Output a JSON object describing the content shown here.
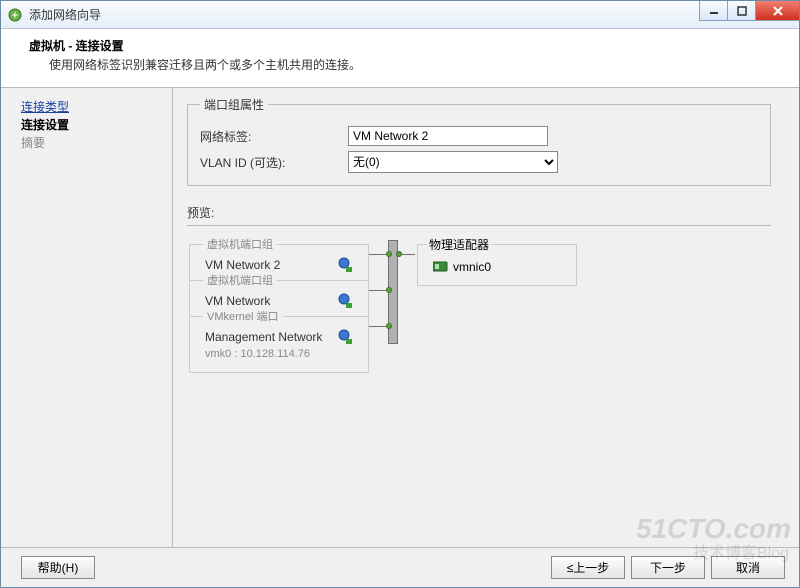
{
  "window": {
    "title": "添加网络向导"
  },
  "header": {
    "title": "虚拟机 - 连接设置",
    "subtitle": "使用网络标签识别兼容迁移且两个或多个主机共用的连接。"
  },
  "sidebar": {
    "steps": [
      {
        "label": "连接类型",
        "state": "link"
      },
      {
        "label": "连接设置",
        "state": "current"
      },
      {
        "label": "摘要",
        "state": "future"
      }
    ]
  },
  "portgroup": {
    "legend": "端口组属性",
    "network_label_label": "网络标签:",
    "network_label_value": "VM Network 2",
    "vlan_label": "VLAN ID (可选):",
    "vlan_value": "无(0)"
  },
  "preview": {
    "label": "预览:",
    "vm_portgroup_legend": "虚拟机端口组",
    "vmkernel_legend": "VMkernel 端口",
    "adapter_legend": "物理适配器",
    "groups": [
      {
        "name": "VM Network 2"
      },
      {
        "name": "VM Network"
      }
    ],
    "vmk": {
      "name": "Management Network",
      "detail": "vmk0 : 10.128.114.76"
    },
    "adapter": "vmnic0"
  },
  "buttons": {
    "help": "帮助(H)",
    "back": "≤上一步",
    "next": "下一步",
    "cancel": "取消"
  },
  "watermark": {
    "line1": "51CTO.com",
    "line2": "技术博客Blog"
  }
}
